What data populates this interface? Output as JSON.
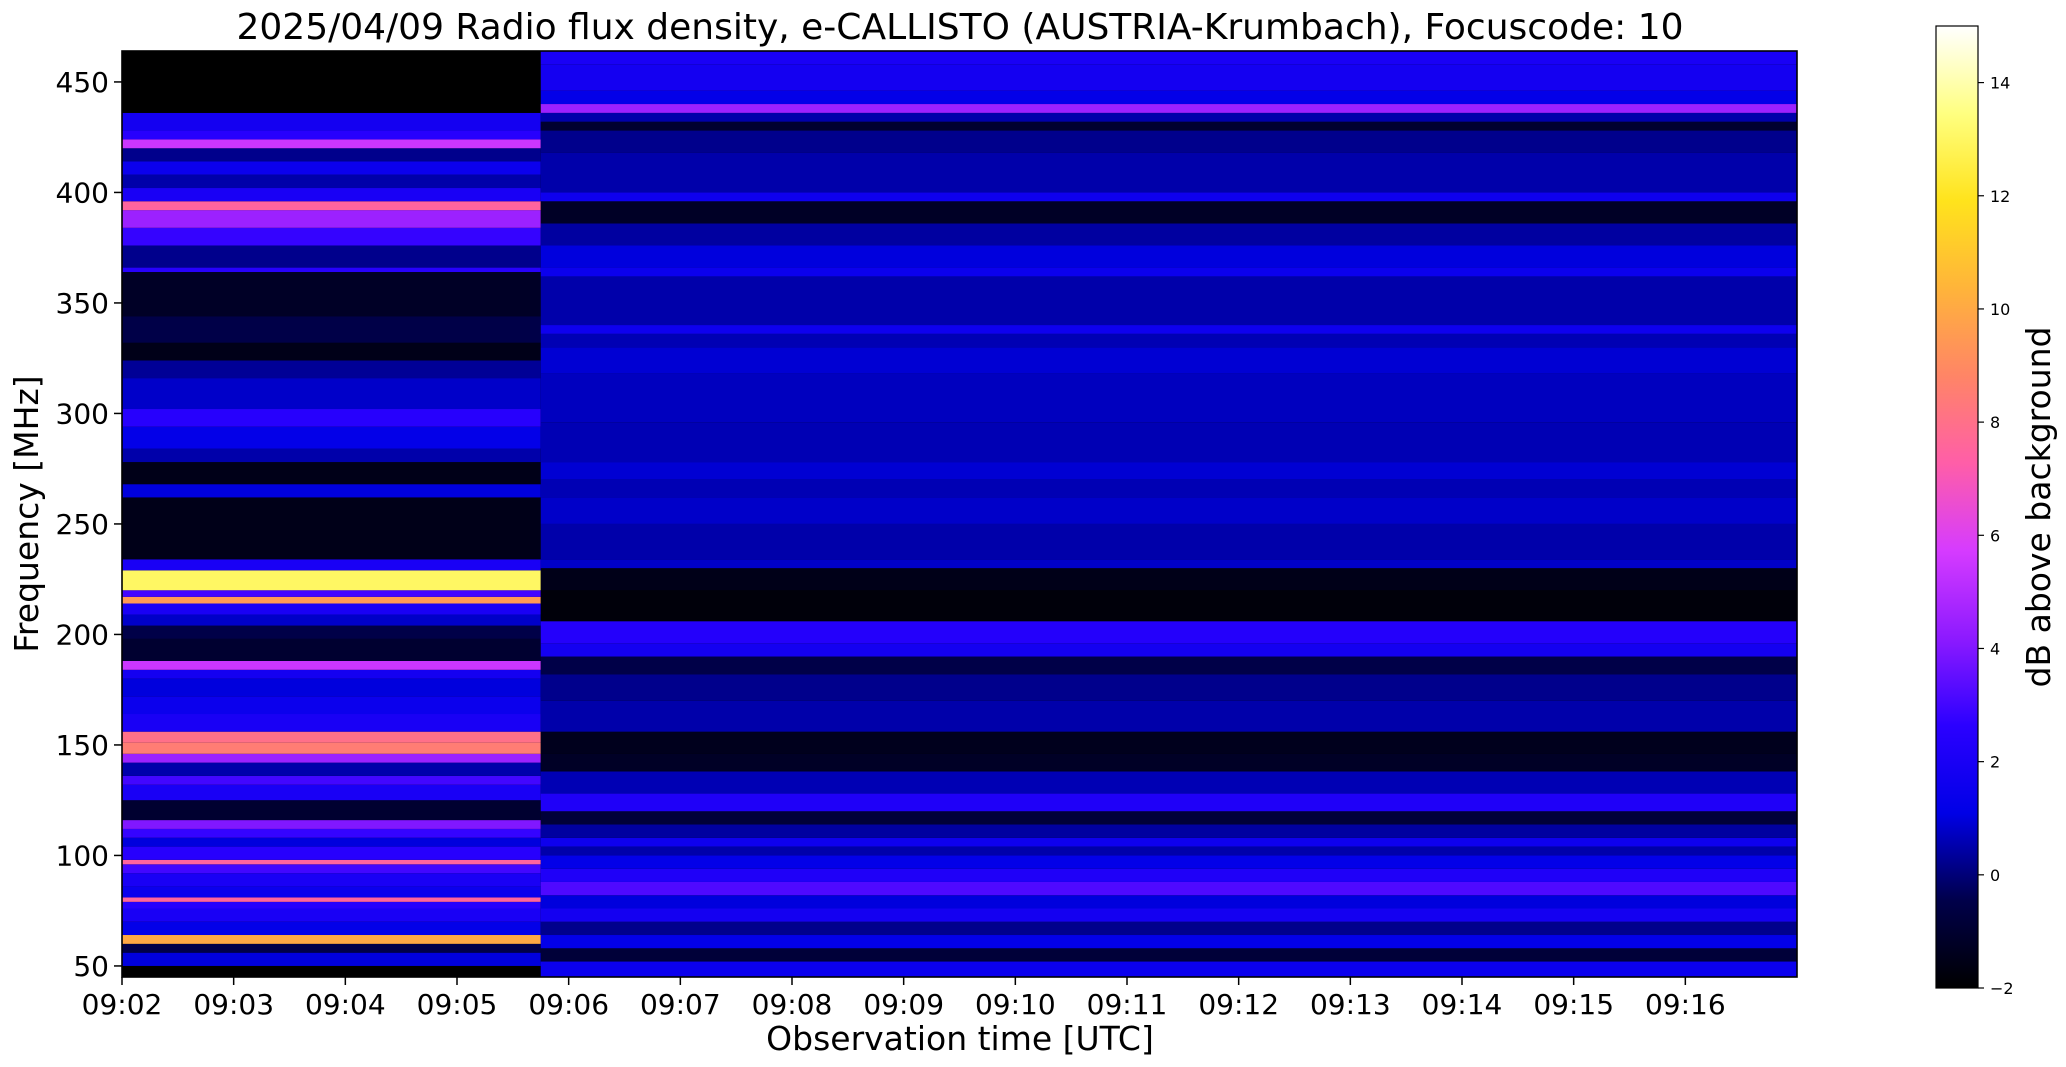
{
  "chart_data": {
    "type": "heatmap",
    "title": "2025/04/09  Radio flux density, e-CALLISTO (AUSTRIA-Krumbach), Focuscode: 10",
    "xlabel": "Observation time [UTC]",
    "ylabel": "Frequency [MHz]",
    "colorbar_label": "dB above background",
    "colormap": "gnuplot2",
    "colormap_stops": [
      "#000000",
      "#00004a",
      "#0000e6",
      "#2b00ff",
      "#8d1aff",
      "#d63bff",
      "#ff5ea8",
      "#ff8566",
      "#ffb43a",
      "#ffe31c",
      "#ffff80",
      "#ffffff"
    ],
    "x_ticks": [
      "09:02",
      "09:03",
      "09:04",
      "09:05",
      "09:06",
      "09:07",
      "09:08",
      "09:09",
      "09:10",
      "09:11",
      "09:12",
      "09:13",
      "09:14",
      "09:15",
      "09:16"
    ],
    "xlim": [
      "09:02:00",
      "09:17:00"
    ],
    "y_ticks": [
      50,
      100,
      150,
      200,
      250,
      300,
      350,
      400,
      450
    ],
    "ylim": [
      45,
      464
    ],
    "colorbar_ticks": [
      -2,
      0,
      2,
      4,
      6,
      8,
      10,
      12,
      14
    ],
    "clim": [
      -2,
      15
    ],
    "segments": [
      {
        "time_range": [
          "09:02:00",
          "09:05:45"
        ],
        "bands": [
          {
            "f": [
              50,
              56
            ],
            "db": 1.0
          },
          {
            "f": [
              56,
              60
            ],
            "db": -0.5
          },
          {
            "f": [
              60,
              64
            ],
            "db": 10.0
          },
          {
            "f": [
              64,
              70
            ],
            "db": 1.2
          },
          {
            "f": [
              70,
              76
            ],
            "db": 2.0
          },
          {
            "f": [
              76,
              79
            ],
            "db": 2.5
          },
          {
            "f": [
              79,
              81
            ],
            "db": 7.5
          },
          {
            "f": [
              81,
              86
            ],
            "db": 1.5
          },
          {
            "f": [
              86,
              92
            ],
            "db": 2.0
          },
          {
            "f": [
              92,
              96
            ],
            "db": 3.0
          },
          {
            "f": [
              96,
              98
            ],
            "db": 7.5
          },
          {
            "f": [
              98,
              104
            ],
            "db": 2.5
          },
          {
            "f": [
              104,
              108
            ],
            "db": 1.0
          },
          {
            "f": [
              108,
              112
            ],
            "db": 2.8
          },
          {
            "f": [
              112,
              116
            ],
            "db": 4.0
          },
          {
            "f": [
              116,
              125
            ],
            "db": -1.0
          },
          {
            "f": [
              125,
              132
            ],
            "db": 2.0
          },
          {
            "f": [
              132,
              136
            ],
            "db": 3.0
          },
          {
            "f": [
              136,
              142
            ],
            "db": 0.5
          },
          {
            "f": [
              142,
              146
            ],
            "db": 4.5
          },
          {
            "f": [
              146,
              151
            ],
            "db": 8.5
          },
          {
            "f": [
              151,
              156
            ],
            "db": 8.0
          },
          {
            "f": [
              156,
              164
            ],
            "db": 2.0
          },
          {
            "f": [
              164,
              172
            ],
            "db": 1.5
          },
          {
            "f": [
              172,
              180
            ],
            "db": 1.0
          },
          {
            "f": [
              180,
              184
            ],
            "db": 1.8
          },
          {
            "f": [
              184,
              188
            ],
            "db": 5.5
          },
          {
            "f": [
              188,
              198
            ],
            "db": -1.0
          },
          {
            "f": [
              198,
              204
            ],
            "db": -0.5
          },
          {
            "f": [
              204,
              209
            ],
            "db": 0.8
          },
          {
            "f": [
              209,
              214
            ],
            "db": 2.0
          },
          {
            "f": [
              214,
              217
            ],
            "db": 9.5
          },
          {
            "f": [
              217,
              220
            ],
            "db": 3.0
          },
          {
            "f": [
              220,
              229
            ],
            "db": 13.0
          },
          {
            "f": [
              229,
              234
            ],
            "db": 2.0
          },
          {
            "f": [
              234,
              262
            ],
            "db": -1.5
          },
          {
            "f": [
              262,
              268
            ],
            "db": 1.0
          },
          {
            "f": [
              268,
              278
            ],
            "db": -1.5
          },
          {
            "f": [
              278,
              284
            ],
            "db": 0.5
          },
          {
            "f": [
              284,
              294
            ],
            "db": 1.2
          },
          {
            "f": [
              294,
              302
            ],
            "db": 2.5
          },
          {
            "f": [
              302,
              316
            ],
            "db": 0.8
          },
          {
            "f": [
              316,
              324
            ],
            "db": 0.3
          },
          {
            "f": [
              324,
              332
            ],
            "db": -1.5
          },
          {
            "f": [
              332,
              344
            ],
            "db": -0.5
          },
          {
            "f": [
              344,
              364
            ],
            "db": -1.2
          },
          {
            "f": [
              364,
              366
            ],
            "db": 2.5
          },
          {
            "f": [
              366,
              376
            ],
            "db": 0.2
          },
          {
            "f": [
              376,
              384
            ],
            "db": 2.8
          },
          {
            "f": [
              384,
              392
            ],
            "db": 4.5
          },
          {
            "f": [
              392,
              396
            ],
            "db": 7.5
          },
          {
            "f": [
              396,
              402
            ],
            "db": 2.0
          },
          {
            "f": [
              402,
              408
            ],
            "db": 0.5
          },
          {
            "f": [
              408,
              414
            ],
            "db": 1.5
          },
          {
            "f": [
              414,
              420
            ],
            "db": 0.2
          },
          {
            "f": [
              420,
              424
            ],
            "db": 5.5
          },
          {
            "f": [
              424,
              428
            ],
            "db": 2.5
          },
          {
            "f": [
              428,
              436
            ],
            "db": 1.8
          },
          {
            "f": [
              436,
              464
            ],
            "db": -2.0
          }
        ]
      },
      {
        "time_range": [
          "09:05:45",
          "09:17:00"
        ],
        "bands": [
          {
            "f": [
              45,
              52
            ],
            "db": 1.5
          },
          {
            "f": [
              52,
              58
            ],
            "db": -0.8
          },
          {
            "f": [
              58,
              64
            ],
            "db": 1.2
          },
          {
            "f": [
              64,
              70
            ],
            "db": 0.2
          },
          {
            "f": [
              70,
              76
            ],
            "db": 1.8
          },
          {
            "f": [
              76,
              82
            ],
            "db": 1.0
          },
          {
            "f": [
              82,
              88
            ],
            "db": 3.2
          },
          {
            "f": [
              88,
              94
            ],
            "db": 2.2
          },
          {
            "f": [
              94,
              100
            ],
            "db": 1.2
          },
          {
            "f": [
              100,
              104
            ],
            "db": 0.5
          },
          {
            "f": [
              104,
              108
            ],
            "db": 1.6
          },
          {
            "f": [
              108,
              114
            ],
            "db": 0.4
          },
          {
            "f": [
              114,
              120
            ],
            "db": -0.8
          },
          {
            "f": [
              120,
              128
            ],
            "db": 2.2
          },
          {
            "f": [
              128,
              138
            ],
            "db": 0.6
          },
          {
            "f": [
              138,
              146
            ],
            "db": -1.2
          },
          {
            "f": [
              146,
              156
            ],
            "db": -1.4
          },
          {
            "f": [
              156,
              170
            ],
            "db": 0.5
          },
          {
            "f": [
              170,
              182
            ],
            "db": 0.2
          },
          {
            "f": [
              182,
              190
            ],
            "db": -0.5
          },
          {
            "f": [
              190,
              196
            ],
            "db": 1.8
          },
          {
            "f": [
              196,
              206
            ],
            "db": 2.4
          },
          {
            "f": [
              206,
              220
            ],
            "db": -1.8
          },
          {
            "f": [
              220,
              230
            ],
            "db": -1.5
          },
          {
            "f": [
              230,
              234
            ],
            "db": 0.8
          },
          {
            "f": [
              234,
              250
            ],
            "db": 0.5
          },
          {
            "f": [
              250,
              262
            ],
            "db": 0.8
          },
          {
            "f": [
              262,
              270
            ],
            "db": 0.6
          },
          {
            "f": [
              270,
              278
            ],
            "db": 0.9
          },
          {
            "f": [
              278,
              296
            ],
            "db": 0.6
          },
          {
            "f": [
              296,
              318
            ],
            "db": 0.7
          },
          {
            "f": [
              318,
              330
            ],
            "db": 0.9
          },
          {
            "f": [
              330,
              336
            ],
            "db": 0.6
          },
          {
            "f": [
              336,
              340
            ],
            "db": 1.6
          },
          {
            "f": [
              340,
              362
            ],
            "db": 0.5
          },
          {
            "f": [
              362,
              366
            ],
            "db": 1.5
          },
          {
            "f": [
              366,
              376
            ],
            "db": 1.0
          },
          {
            "f": [
              376,
              386
            ],
            "db": 0.4
          },
          {
            "f": [
              386,
              396
            ],
            "db": -1.2
          },
          {
            "f": [
              396,
              400
            ],
            "db": 1.6
          },
          {
            "f": [
              400,
              418
            ],
            "db": 0.5
          },
          {
            "f": [
              418,
              428
            ],
            "db": 0.2
          },
          {
            "f": [
              428,
              432
            ],
            "db": -1.0
          },
          {
            "f": [
              432,
              436
            ],
            "db": 0.5
          },
          {
            "f": [
              436,
              440
            ],
            "db": 4.5
          },
          {
            "f": [
              440,
              446
            ],
            "db": 1.2
          },
          {
            "f": [
              446,
              458
            ],
            "db": 1.8
          },
          {
            "f": [
              458,
              464
            ],
            "db": 2.0
          }
        ]
      }
    ]
  }
}
